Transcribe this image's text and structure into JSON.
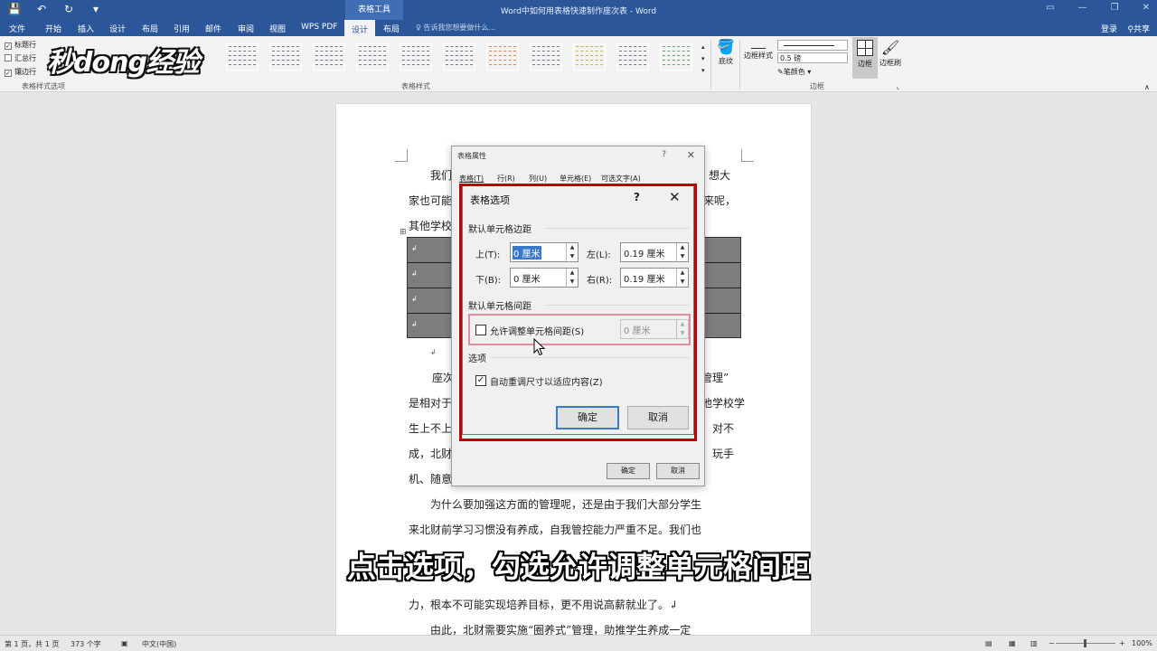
{
  "titlebar": {
    "context_tab": "表格工具",
    "document_title": "Word中如何用表格快速制作座次表 - Word"
  },
  "tabs": [
    "文件",
    "开始",
    "插入",
    "设计",
    "布局",
    "引用",
    "邮件",
    "审阅",
    "视图",
    "WPS PDF",
    "设计",
    "布局"
  ],
  "tell_me": "告诉我您想要做什么...",
  "account": {
    "login": "登录",
    "share": "共享"
  },
  "ribbon": {
    "style_options": [
      "标题行",
      "汇总行",
      "镶边行"
    ],
    "style_options_group": "表格样式选项",
    "table_styles_group": "表格样式",
    "shading": "底纹",
    "border_styles": "边框样式",
    "weight": "0.5 磅",
    "pen_color": "笔颜色",
    "borders": "边框",
    "border_painter": "边框刷",
    "borders_group": "边框"
  },
  "watermark": "秒dong经验",
  "document": {
    "lines": [
      "我们",
      "家也可能",
      "其他学校",
      "座次",
      "是相对于",
      "生上不上",
      "成，北财",
      "机、随意",
      "为什么要加强这方面的管理呢，还是由于我们大部分学生",
      "来北财前学习习惯没有养成，自我管控能力严重不足。我们也",
      "力，根本不可能实现培养目标，更不用说高薪就业了。↲",
      "由此，北财需要实施“圈养式”管理，助推学生养成一定"
    ],
    "right_fragments": [
      "想大",
      "来呢，",
      "管理”",
      "其他学校学",
      "对不",
      "玩手"
    ]
  },
  "parent_dialog": {
    "title": "表格属性",
    "tabs": [
      "表格(T)",
      "行(R)",
      "列(U)",
      "单元格(E)",
      "可选文字(A)"
    ],
    "ok": "确定",
    "cancel": "取消"
  },
  "dialog": {
    "title": "表格选项",
    "help": "?",
    "close": "✕",
    "margins_section": "默认单元格边距",
    "top_label": "上(T):",
    "top_value": "0 厘米",
    "left_label": "左(L):",
    "left_value": "0.19 厘米",
    "bottom_label": "下(B):",
    "bottom_value": "0 厘米",
    "right_label": "右(R):",
    "right_value": "0.19 厘米",
    "spacing_section": "默认单元格间距",
    "allow_spacing_label": "允许调整单元格间距(S)",
    "allow_spacing_checked": false,
    "spacing_value": "0 厘米",
    "options_section": "选项",
    "autofit_label": "自动重调尺寸以适应内容(Z)",
    "autofit_checked": true,
    "ok": "确定",
    "cancel": "取消"
  },
  "subtitle": "点击选项，勾选允许调整单元格间距",
  "statusbar": {
    "page": "第 1 页，共 1 页",
    "words": "373 个字",
    "language": "中文(中国)",
    "zoom": "100%"
  },
  "colors": {
    "titlebar": "#2b579a",
    "highlight": "#c00000",
    "selection": "#3a78c9"
  }
}
